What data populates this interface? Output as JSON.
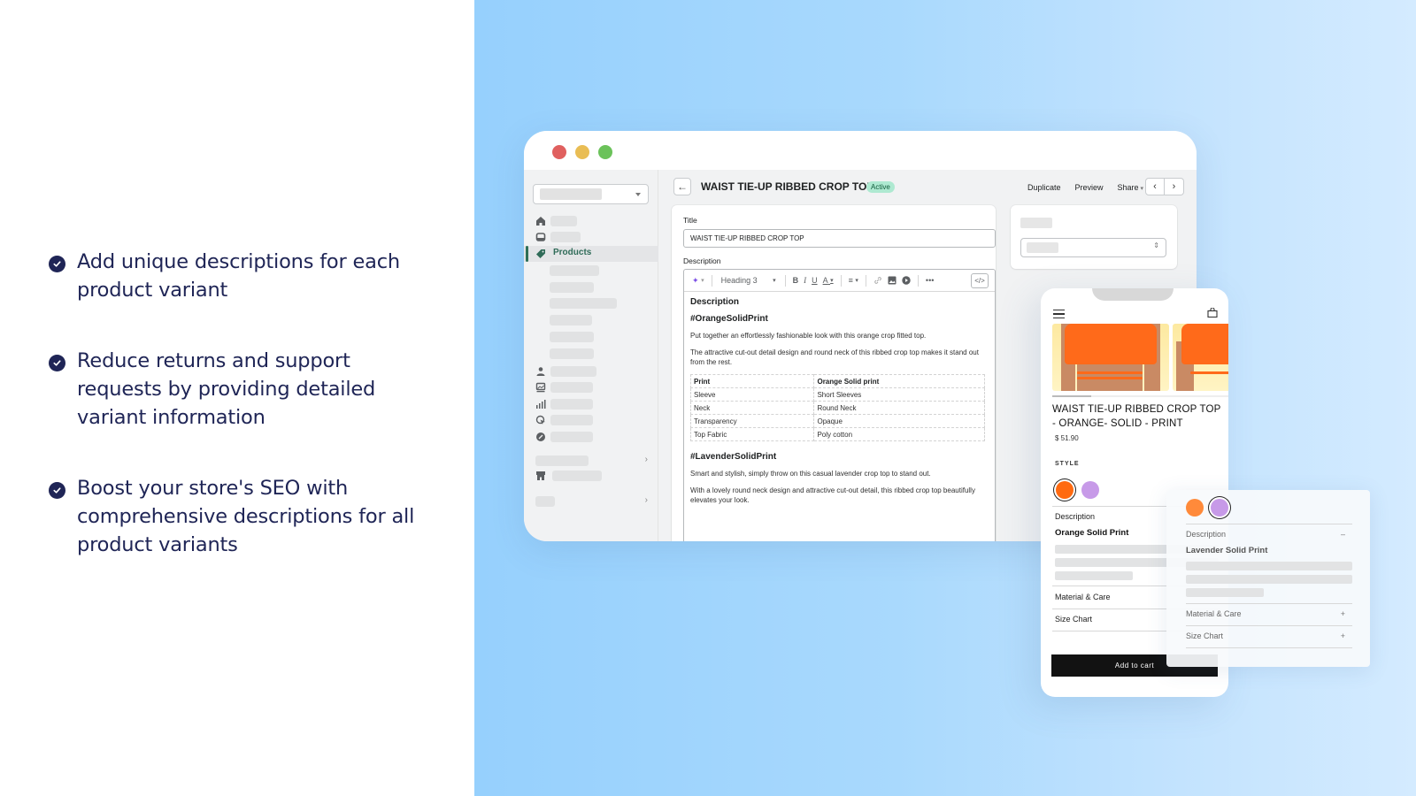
{
  "features": [
    {
      "icon": "check-circle-icon",
      "text": "Add unique descriptions for each product variant"
    },
    {
      "icon": "check-circle-icon",
      "text": "Reduce returns and support requests by providing detailed variant information"
    },
    {
      "icon": "check-circle-icon",
      "text": "Boost your store's SEO with comprehensive descriptions for all product variants"
    }
  ],
  "colors": {
    "feature_text": "#1f2556",
    "background_accent": "#96d0fd",
    "active_badge_bg": "#aee9d1",
    "products_nav": "#2f6b58",
    "swatch_orange": "#ff6a10",
    "swatch_lavender": "#c79ae8",
    "ai_icon": "#7b4fe6"
  },
  "admin": {
    "window_controls": [
      "close",
      "minimize",
      "maximize"
    ],
    "sidebar": {
      "active_item": "Products",
      "icons": [
        "home-icon",
        "orders-icon",
        "tag-icon",
        "customers-icon",
        "content-icon",
        "analytics-icon",
        "marketing-icon",
        "discounts-icon",
        "store-icon"
      ]
    },
    "header": {
      "title": "WAIST TIE-UP RIBBED CROP TOP",
      "status": "Active",
      "actions": {
        "duplicate": "Duplicate",
        "preview": "Preview",
        "share": "Share"
      },
      "prev": "‹",
      "next": "›",
      "back": "←"
    },
    "form": {
      "title_label": "Title",
      "title_value": "WAIST TIE-UP RIBBED CROP TOP",
      "description_label": "Description",
      "toolbar": {
        "ai": "✦",
        "heading": "Heading 3",
        "bold": "B",
        "italic": "I",
        "underline": "U",
        "color": "A",
        "align": "≡",
        "link": "🔗",
        "image": "▣",
        "video": "●",
        "more": "•••",
        "code": "</>"
      },
      "content": {
        "heading": "Description",
        "orange_heading": "#OrangeSolidPrint",
        "orange_p1": "Put together an effortlessly fashionable look with this orange crop fitted top.",
        "orange_p2": "The attractive cut-out detail design and round neck of this ribbed crop top makes it stand out from the rest.",
        "table": [
          [
            "Print",
            "Orange Solid print"
          ],
          [
            "Sleeve",
            "Short Sleeves"
          ],
          [
            "Neck",
            "Round Neck"
          ],
          [
            "Transparency",
            "Opaque"
          ],
          [
            "Top Fabric",
            "Poly cotton"
          ]
        ],
        "lavender_heading": "#LavenderSolidPrint",
        "lavender_p1": "Smart and stylish, simply throw on this casual lavender crop top to stand out.",
        "lavender_p2": "With a lovely round neck design and attractive cut-out detail, this ribbed crop top beautifully elevates your look."
      }
    }
  },
  "storefront": {
    "product_title": "WAIST TIE-UP RIBBED CROP TOP - ORANGE- SOLID - PRINT",
    "price": "$ 51.90",
    "style_label": "STYLE",
    "swatches": [
      "Orange",
      "Lavender"
    ],
    "selected_swatch": "Orange",
    "description_label": "Description",
    "variant_name": "Orange Solid Print",
    "material_care": "Material & Care",
    "size_chart": "Size Chart",
    "add_to_cart": "Add to cart"
  },
  "overlay": {
    "selected_swatch": "Lavender",
    "description_label": "Description",
    "variant_name": "Lavender Solid Print",
    "material_care": "Material & Care",
    "size_chart": "Size Chart",
    "collapse": "–",
    "expand": "+"
  }
}
